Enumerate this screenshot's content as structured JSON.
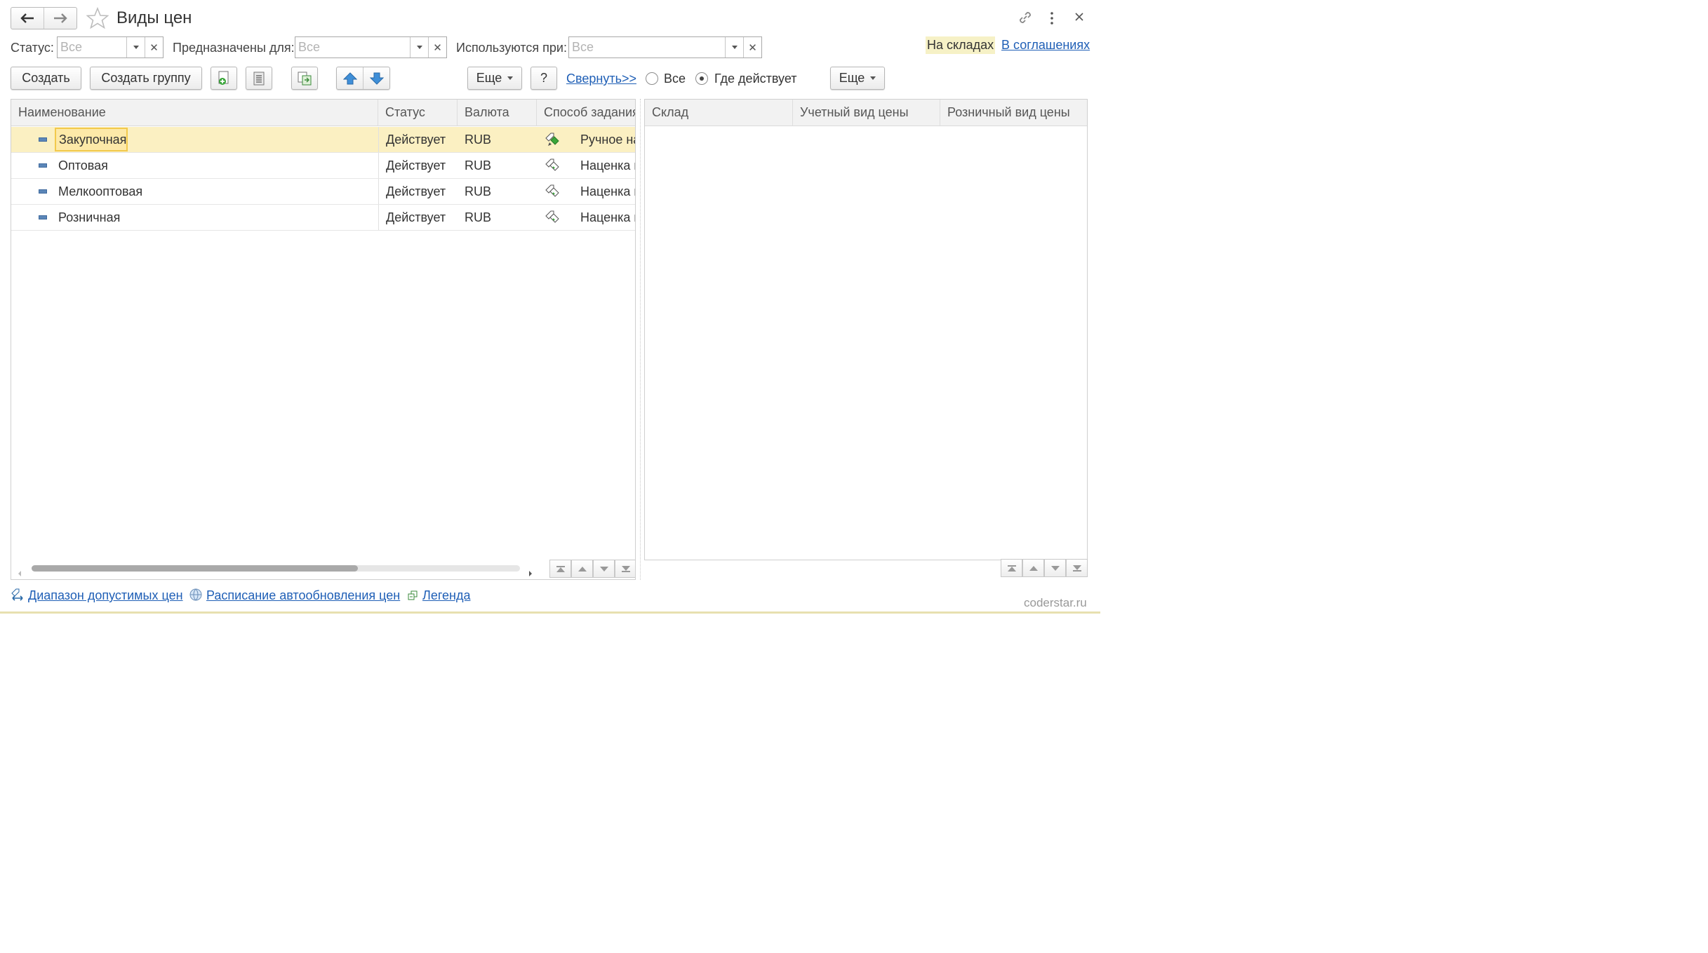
{
  "header": {
    "title": "Виды цен"
  },
  "filters": {
    "status_label": "Статус:",
    "status_value": "Все",
    "purpose_label": "Предназначены для:",
    "purpose_value": "Все",
    "used_label": "Используются при:",
    "used_value": "Все"
  },
  "top_links": {
    "warehouses": "На складах",
    "agreements": "В соглашениях"
  },
  "toolbar": {
    "create": "Создать",
    "create_group": "Создать группу",
    "more": "Еще",
    "help": "?",
    "collapse": "Свернуть>>"
  },
  "right_toolbar": {
    "radio_all": "Все",
    "radio_where": "Где действует",
    "more": "Еще"
  },
  "table": {
    "columns": [
      "Наименование",
      "Статус",
      "Валюта",
      "Способ задания"
    ],
    "rows": [
      {
        "name": "Закупочная",
        "status": "Действует",
        "currency": "RUB",
        "method": "Ручное на"
      },
      {
        "name": "Оптовая",
        "status": "Действует",
        "currency": "RUB",
        "method": "Наценка н"
      },
      {
        "name": "Мелкооптовая",
        "status": "Действует",
        "currency": "RUB",
        "method": "Наценка н"
      },
      {
        "name": "Розничная",
        "status": "Действует",
        "currency": "RUB",
        "method": "Наценка н"
      }
    ]
  },
  "right_table": {
    "columns": [
      "Склад",
      "Учетный вид цены",
      "Розничный вид цены"
    ]
  },
  "footer": {
    "link1": "Диапазон допустимых цен",
    "link2": "Расписание автообновления цен",
    "link3": "Легенда",
    "watermark": "coderstar.ru"
  },
  "colors": {
    "selected_row": "#fbf0c2",
    "link": "#1f5fb6",
    "highlight_label": "#f6f1c6"
  }
}
